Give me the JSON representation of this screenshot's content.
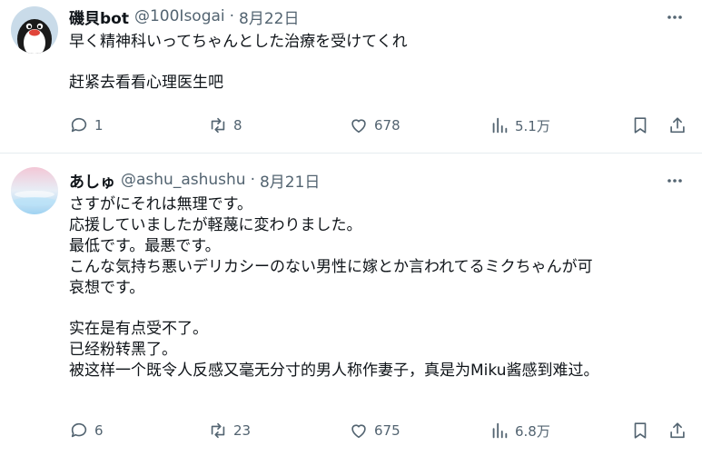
{
  "tweets": [
    {
      "author_name": "磯貝bot",
      "handle": "@100Isogai",
      "separator": "·",
      "date": "8月22日",
      "paragraphs": [
        [
          "早く精神科いってちゃんとした治療を受けてくれ"
        ],
        [
          "赶紧去看看心理医生吧"
        ]
      ],
      "replies": "1",
      "retweets": "8",
      "likes": "678",
      "views": "5.1万"
    },
    {
      "author_name": "あしゅ",
      "handle": "@ashu_ashushu",
      "separator": "·",
      "date": "8月21日",
      "paragraphs": [
        [
          "さすがにそれは無理です。",
          "応援していましたが軽蔑に変わりました。",
          "最低です。最悪です。",
          "こんな気持ち悪いデリカシーのない男性に嫁とか言われてるミクちゃんが可",
          "哀想です。"
        ],
        [
          "实在是有点受不了。",
          "已经粉转黑了。",
          "被这样一个既令人反感又毫无分寸的男人称作妻子，真是为Miku酱感到难过。"
        ]
      ],
      "replies": "6",
      "retweets": "23",
      "likes": "675",
      "views": "6.8万"
    }
  ],
  "icons": {
    "more": "more-horizontal-icon",
    "reply": "reply-icon",
    "retweet": "retweet-icon",
    "like": "heart-icon",
    "views": "views-chart-icon",
    "bookmark": "bookmark-icon",
    "share": "share-icon"
  },
  "colors": {
    "text": "#0f1419",
    "secondary": "#536471",
    "divider": "#e6ecf0"
  }
}
